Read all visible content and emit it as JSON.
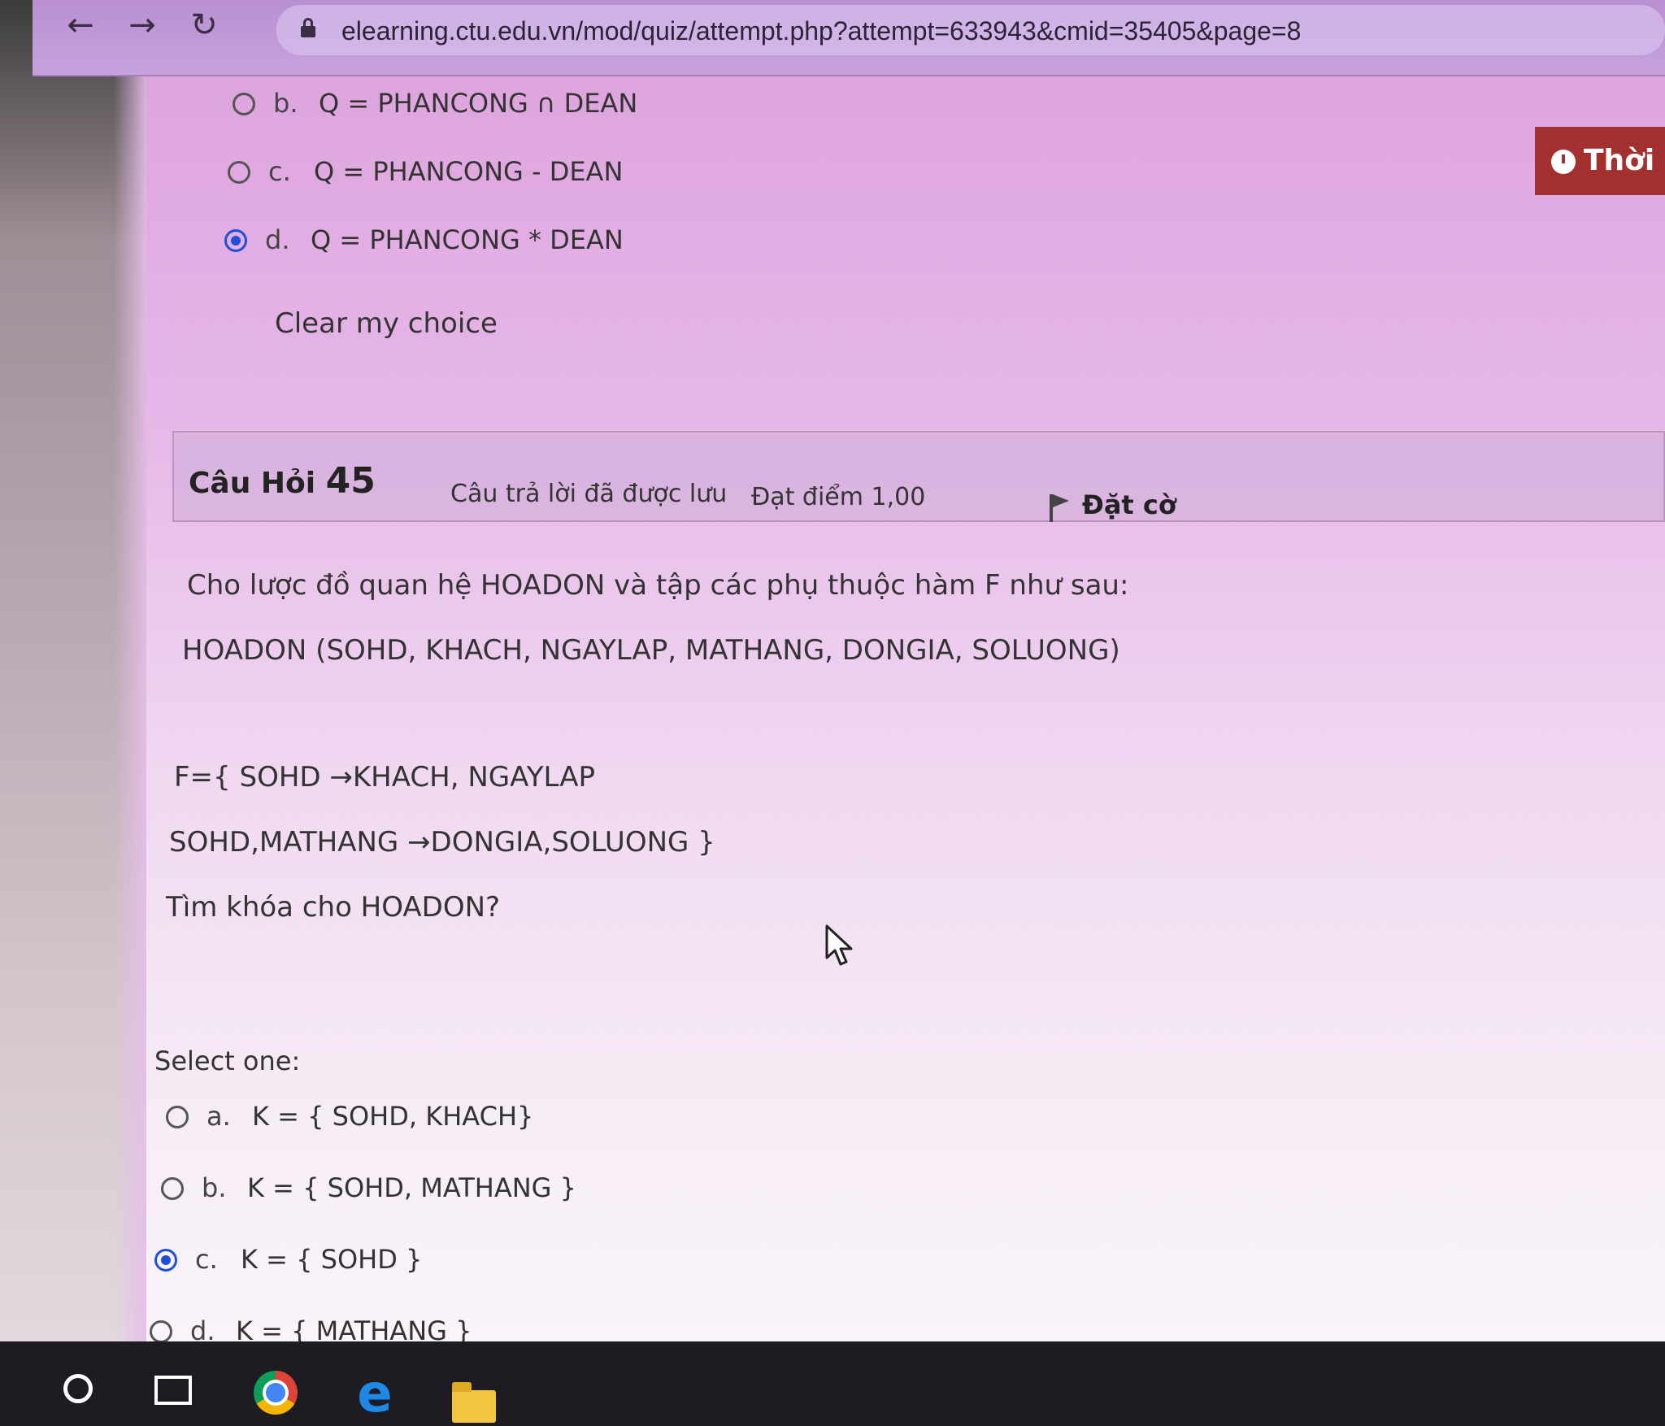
{
  "browser": {
    "url": "elearning.ctu.edu.vn/mod/quiz/attempt.php?attempt=633943&cmid=35405&page=8"
  },
  "timer": {
    "label": "Thời"
  },
  "prev_question": {
    "options": [
      {
        "letter": "b.",
        "text": "Q = PHANCONG ∩ DEAN",
        "checked": false
      },
      {
        "letter": "c.",
        "text": "Q = PHANCONG - DEAN",
        "checked": false
      },
      {
        "letter": "d.",
        "text": "Q = PHANCONG * DEAN",
        "checked": true
      }
    ],
    "clear_label": "Clear my choice"
  },
  "question": {
    "label": "Câu Hỏi",
    "number": "45",
    "state": "Câu trả lời đã được lưu",
    "grade": "Đạt điểm 1,00",
    "flag_label": "Đặt cờ",
    "text_lines": [
      "Cho lược đồ quan hệ HOADON và tập các phụ thuộc hàm F như sau:",
      "HOADON (SOHD, KHACH, NGAYLAP, MATHANG, DONGIA, SOLUONG)",
      "F={ SOHD →KHACH, NGAYLAP",
      "SOHD,MATHANG →DONGIA,SOLUONG }",
      "Tìm khóa cho HOADON?"
    ],
    "select_label": "Select one:",
    "options": [
      {
        "letter": "a.",
        "text": "K = { SOHD, KHACH}",
        "checked": false
      },
      {
        "letter": "b.",
        "text": "K = { SOHD, MATHANG }",
        "checked": false
      },
      {
        "letter": "c.",
        "text": "K = { SOHD }",
        "checked": true
      },
      {
        "letter": "d.",
        "text": "K = { MATHANG }",
        "checked": false
      }
    ]
  },
  "taskbar": {
    "icons": [
      "search-circle-icon",
      "task-view-icon",
      "chrome-icon",
      "edge-icon",
      "file-explorer-icon"
    ]
  },
  "colors": {
    "timer_bg": "#a3302f",
    "radio_checked": "#1e4fd8",
    "taskbar_bg": "#1c1c22"
  }
}
